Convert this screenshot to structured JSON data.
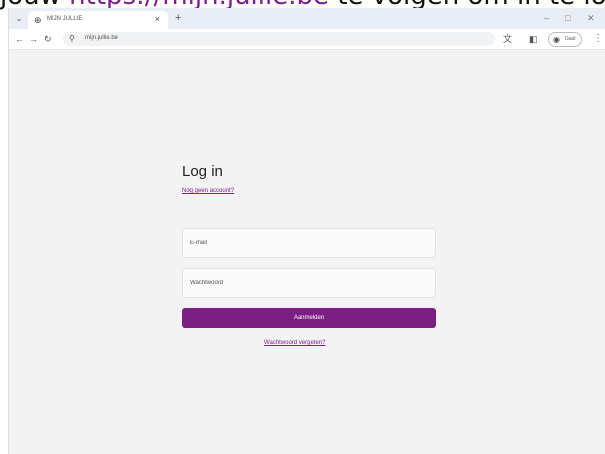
{
  "intro": {
    "prefix": "jouw ",
    "url": "https://mijn.jullie.be",
    "suffix": " te volgen om in te loggen in mijn jullie"
  },
  "browser": {
    "tab_title": "MIJN JULLIE",
    "url": "mijn.jullie.be",
    "profile_label": "Gast"
  },
  "login": {
    "title": "Log in",
    "register_link": "Nog geen account?",
    "email_placeholder": "E-mail",
    "password_placeholder": "Wachtwoord",
    "submit_label": "Aanmelden",
    "forgot_link": "Wachtwoord vergeten?"
  },
  "icons": {
    "tab_menu": "chevron-down-icon",
    "tab_favicon": "globe-icon",
    "tab_close": "close-icon",
    "new_tab": "plus-icon",
    "back": "arrow-left-icon",
    "forward": "arrow-right-icon",
    "reload": "reload-icon",
    "site_info": "tune-icon",
    "translate": "translate-icon",
    "side_panel": "side-panel-icon",
    "profile": "avatar-icon",
    "menu": "kebab-icon"
  },
  "colors": {
    "accent": "#7b1f82",
    "page_bg": "#f3f3f3",
    "link": "#7a1f8e"
  }
}
